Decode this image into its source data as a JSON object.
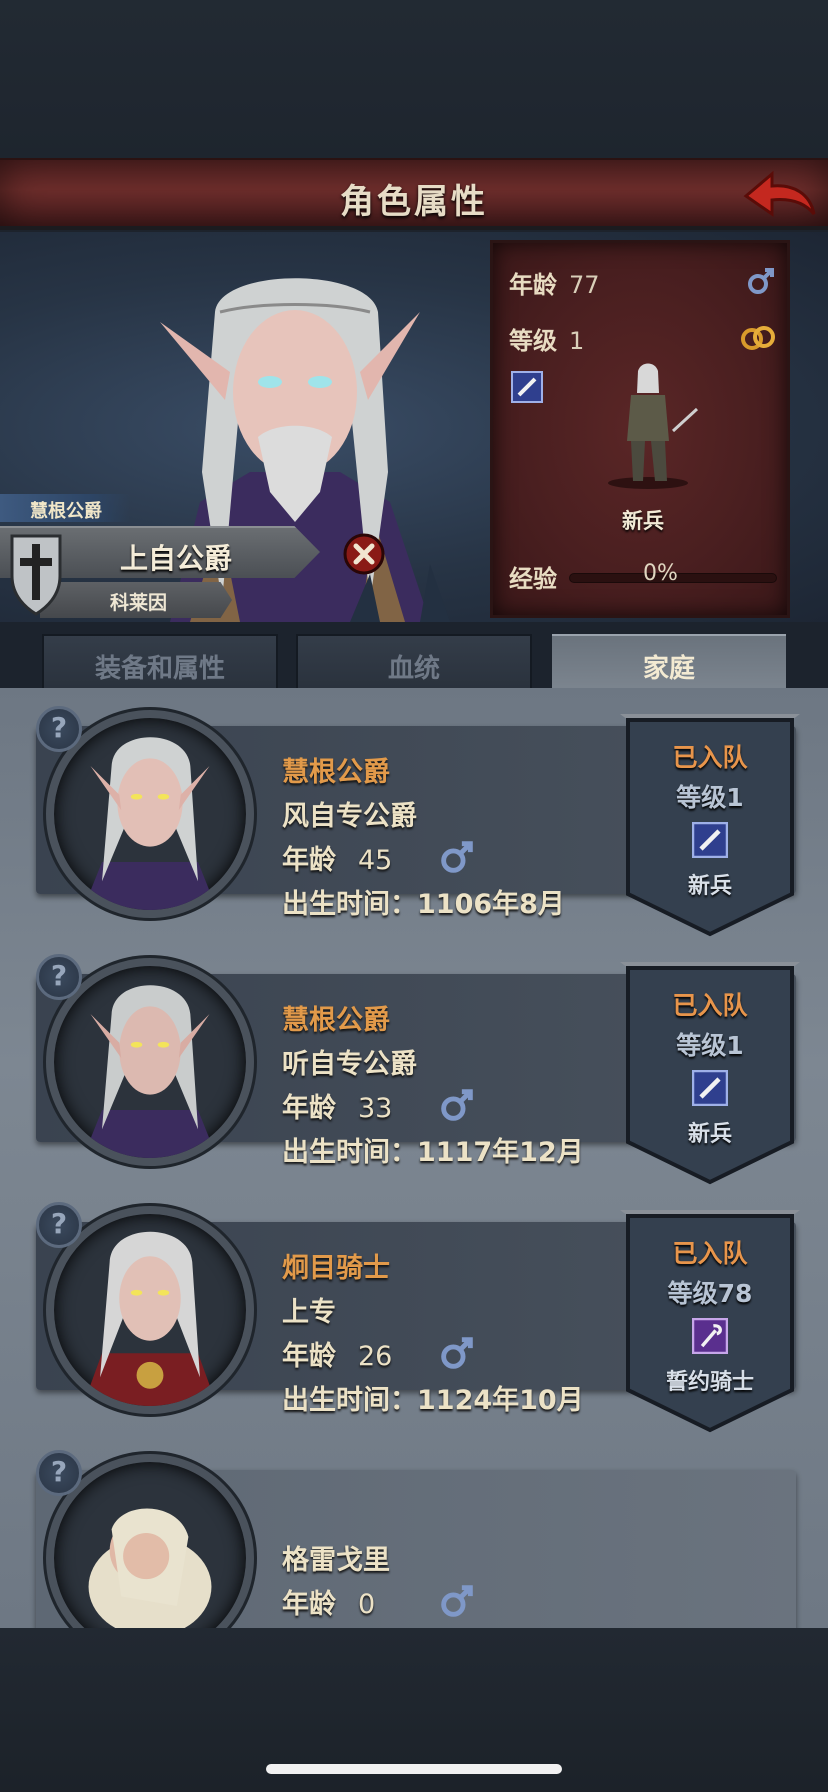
{
  "header": {
    "title": "角色属性"
  },
  "character": {
    "title_label": "慧根公爵",
    "rank": "上自公爵",
    "name": "科莱因",
    "stats": {
      "age_label": "年龄",
      "age": "77",
      "level_label": "等级",
      "level": "1",
      "unit_class": "新兵",
      "exp_label": "经验",
      "exp": "0%",
      "exp_fraction": 0
    }
  },
  "tabs": [
    {
      "label": "装备和属性"
    },
    {
      "label": "血统"
    },
    {
      "label": "家庭"
    }
  ],
  "members": [
    {
      "title": "慧根公爵",
      "rank": "风自专公爵",
      "age_label": "年龄",
      "age": "45",
      "birth_label": "出生时间：",
      "birth": "1106年8月",
      "status": "已入队",
      "level_label": "等级",
      "level": "1",
      "unit_class": "新兵"
    },
    {
      "title": "慧根公爵",
      "rank": "听自专公爵",
      "age_label": "年龄",
      "age": "33",
      "birth_label": "出生时间：",
      "birth": "1117年12月",
      "status": "已入队",
      "level_label": "等级",
      "level": "1",
      "unit_class": "新兵"
    },
    {
      "title": "炯目骑士",
      "rank": "上专",
      "age_label": "年龄",
      "age": "26",
      "birth_label": "出生时间：",
      "birth": "1124年10月",
      "status": "已入队",
      "level_label": "等级",
      "level": "78",
      "unit_class": "誓约骑士"
    },
    {
      "name": "格雷戈里",
      "age_label": "年龄",
      "age": "0"
    }
  ],
  "icons": {
    "back": "back-arrow-icon",
    "male": "male-symbol-icon",
    "married": "rings-icon",
    "sword": "sword-class-icon",
    "staff": "staff-class-icon",
    "help": "question-icon",
    "shield": "shield-icon",
    "dismiss": "close-icon"
  },
  "colors": {
    "accent_orange": "#e29a4a",
    "title_red": "#6f2e2c",
    "male_blue": "#7f98c8"
  }
}
